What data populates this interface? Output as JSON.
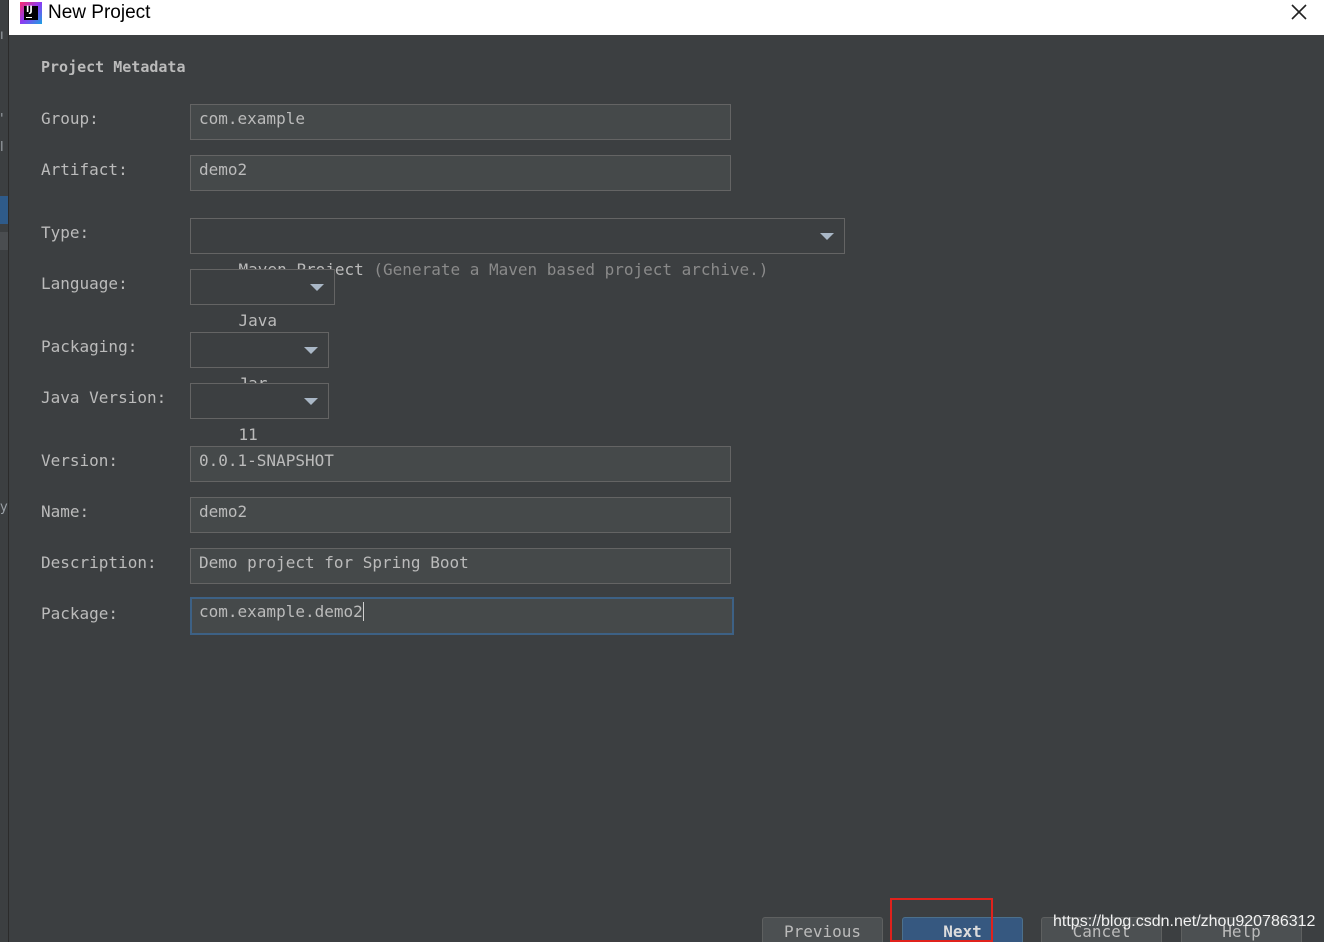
{
  "window": {
    "title": "New Project"
  },
  "section": {
    "title": "Project Metadata"
  },
  "fields": {
    "group": {
      "label": "Group:",
      "value": "com.example"
    },
    "artifact": {
      "label": "Artifact:",
      "value": "demo2"
    },
    "type": {
      "label": "Type:",
      "value": "Maven Project",
      "hint": "(Generate a Maven based project archive.)"
    },
    "language": {
      "label": "Language:",
      "value": "Java"
    },
    "packaging": {
      "label": "Packaging:",
      "value": "Jar"
    },
    "java_version": {
      "label": "Java Version:",
      "value": "11"
    },
    "version": {
      "label": "Version:",
      "value": "0.0.1-SNAPSHOT"
    },
    "name": {
      "label": "Name:",
      "value": "demo2"
    },
    "description": {
      "label": "Description:",
      "value": "Demo project for Spring Boot"
    },
    "package": {
      "label": "Package:",
      "value": "com.example.demo2"
    }
  },
  "buttons": {
    "previous": "Previous",
    "next": "Next",
    "cancel": "Cancel",
    "help": "Help"
  },
  "watermark": "https://blog.csdn.net/zhou920786312",
  "colors": {
    "dialog_bg": "#3c3f41",
    "input_bg": "#45494a",
    "text": "#bbbbbb",
    "primary_button": "#365880",
    "focus_border": "#3d6185",
    "highlight": "#e0221c"
  }
}
